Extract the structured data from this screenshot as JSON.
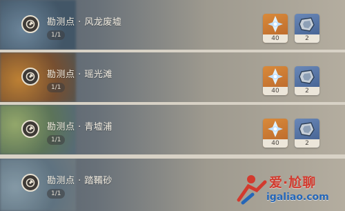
{
  "list": {
    "items": [
      {
        "title": "勘测点 · 风龙废墟",
        "progress": "1/1",
        "rewards": [
          {
            "icon": "primogem-icon",
            "qty": "40"
          },
          {
            "icon": "ore-icon",
            "qty": "2"
          }
        ]
      },
      {
        "title": "勘测点 · 瑶光滩",
        "progress": "1/1",
        "rewards": [
          {
            "icon": "primogem-icon",
            "qty": "40"
          },
          {
            "icon": "ore-icon",
            "qty": "2"
          }
        ]
      },
      {
        "title": "勘测点 · 青墟浦",
        "progress": "1/1",
        "rewards": [
          {
            "icon": "primogem-icon",
            "qty": "40"
          },
          {
            "icon": "ore-icon",
            "qty": "2"
          }
        ]
      },
      {
        "title": "勘测点 · 踏鞴砂",
        "progress": "1/1",
        "rewards": []
      }
    ]
  },
  "watermark": {
    "text": "爱·尬聊",
    "url": "igaliao.com"
  },
  "colors": {
    "primogem_bg": "#d98a3a",
    "ore_bg": "#5173a6",
    "qty_bg": "#ece6da",
    "title_text": "#f2ece0",
    "watermark_red": "#d23a2e",
    "watermark_blue": "#2466b8"
  }
}
